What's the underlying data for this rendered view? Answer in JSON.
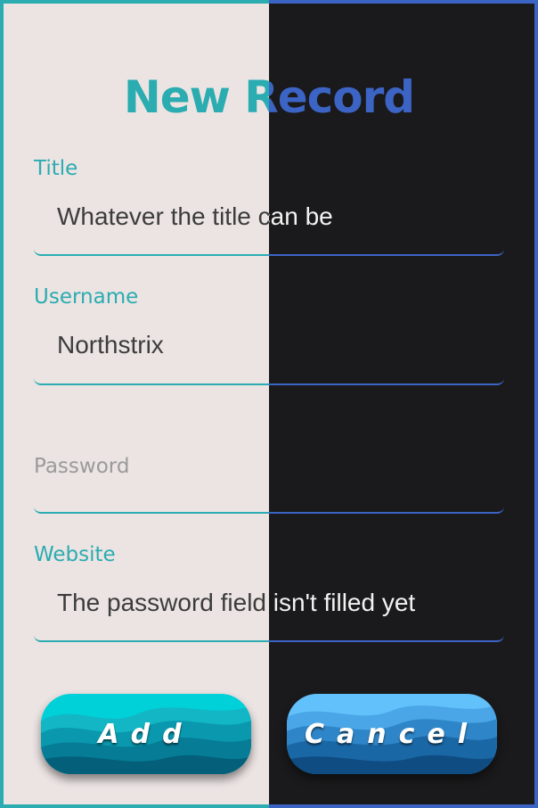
{
  "form": {
    "heading": "New Record",
    "fields": {
      "title": {
        "label": "Title",
        "value": "Whatever the title can be"
      },
      "username": {
        "label": "Username",
        "value": "Northstrix"
      },
      "password": {
        "label": "Password",
        "value": ""
      },
      "website": {
        "label": "Website",
        "value": "The password field isn't filled yet"
      }
    },
    "buttons": {
      "add": "Add",
      "cancel": "Cancel"
    }
  },
  "colors": {
    "accent_teal": "#2aacb0",
    "accent_blue": "#3c64c4",
    "panel_light": "#ece4e3",
    "panel_dark": "#1a1a1c"
  }
}
